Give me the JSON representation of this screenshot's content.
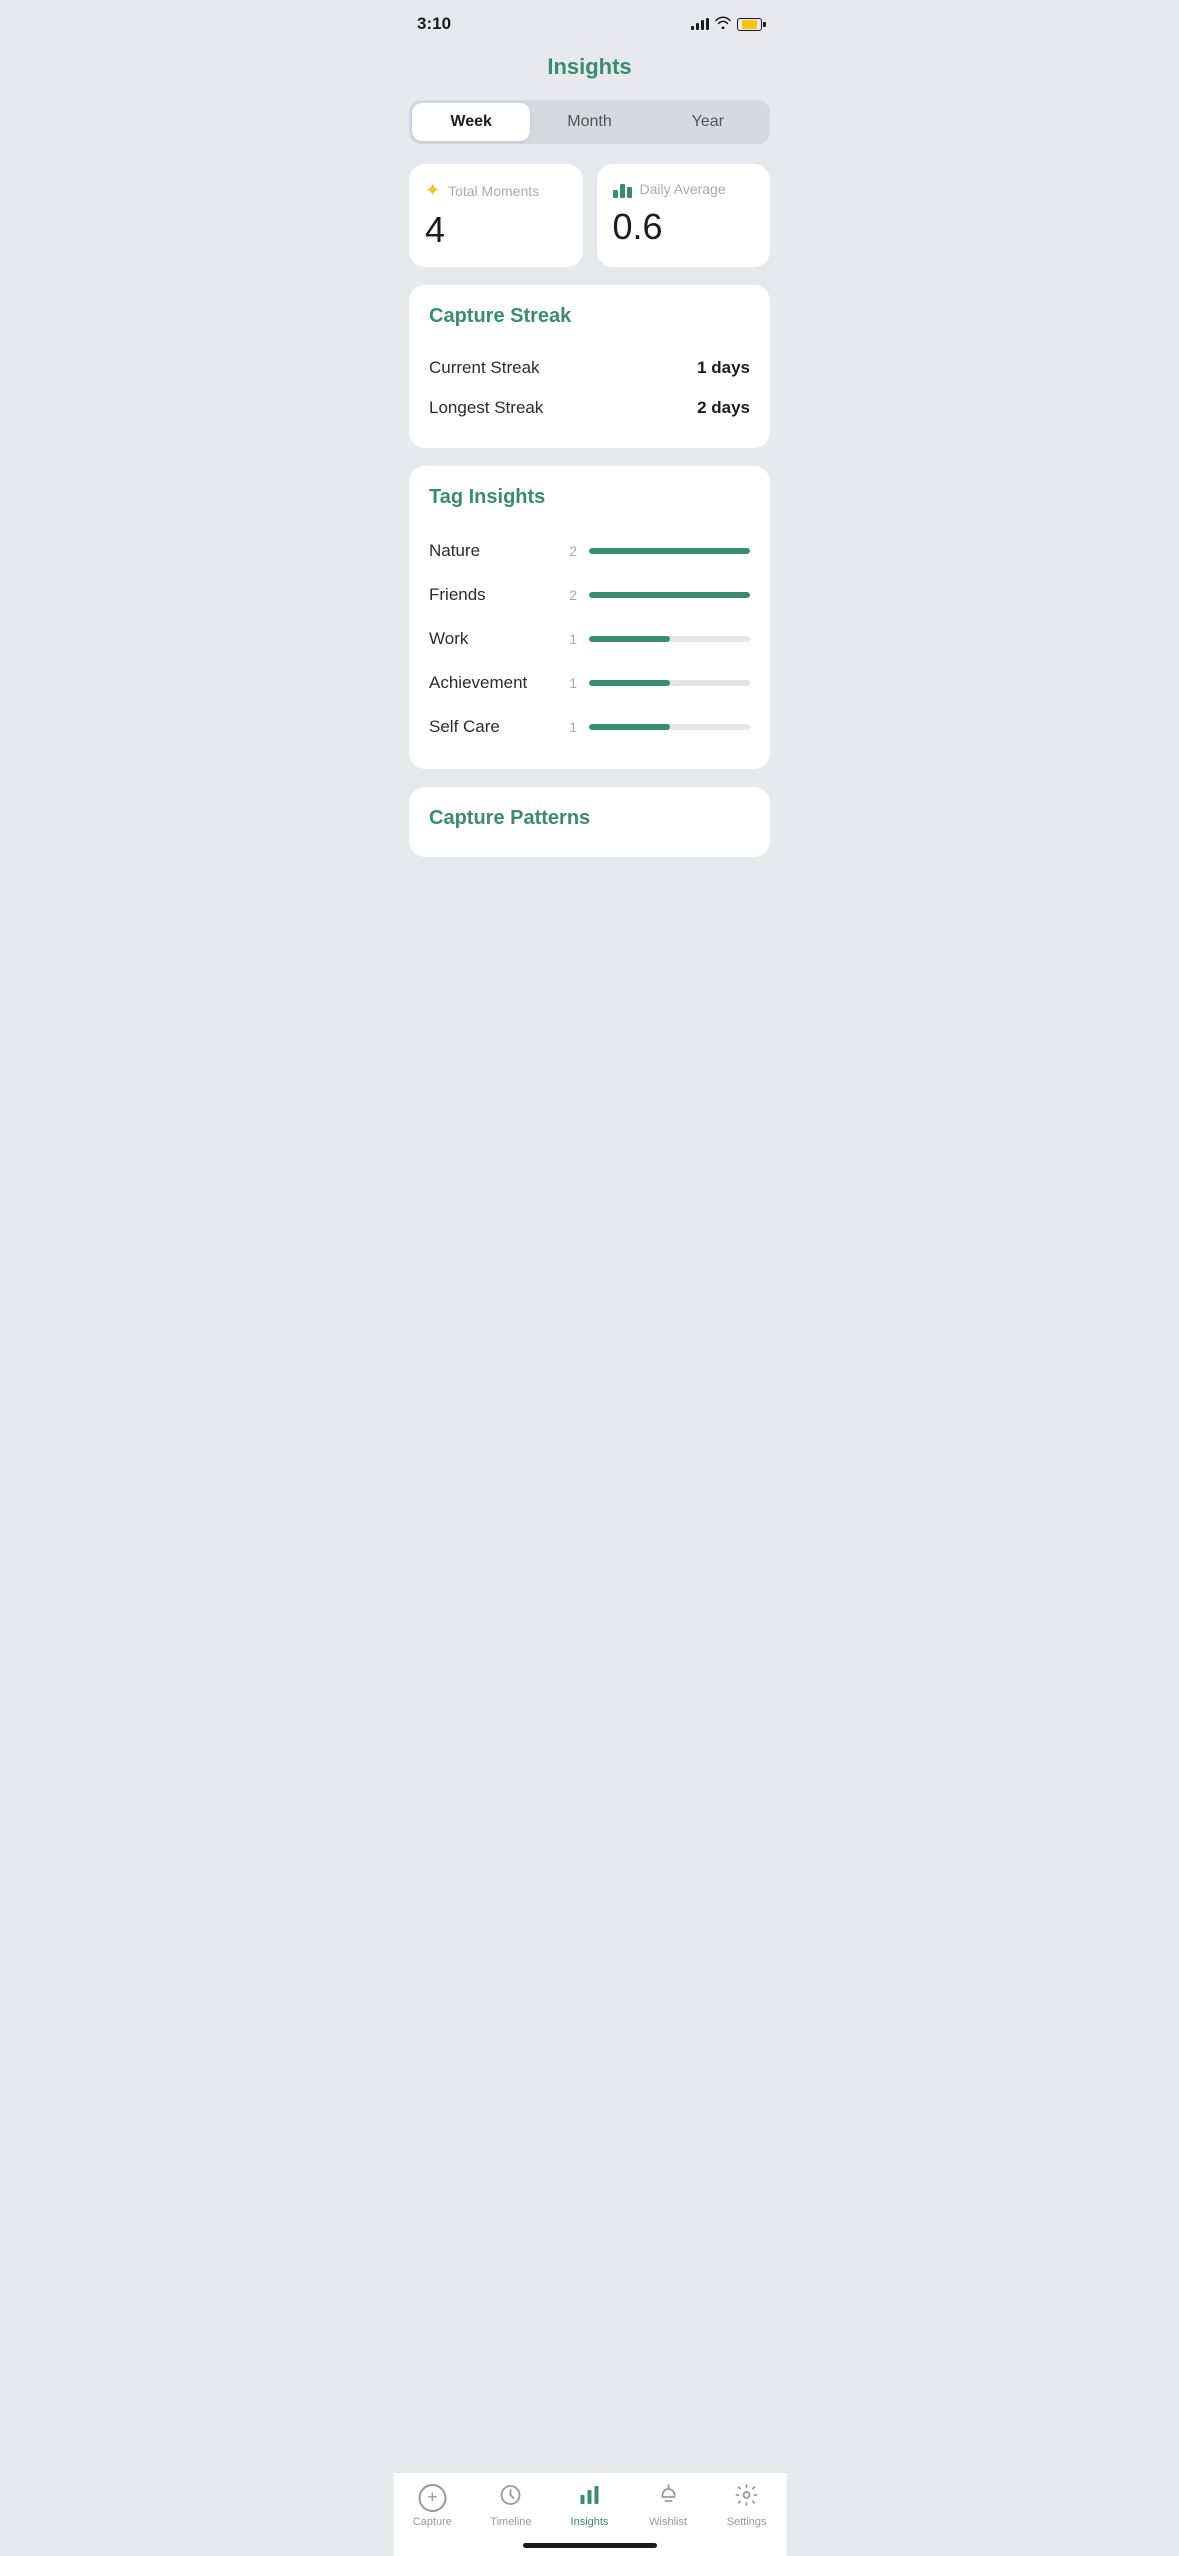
{
  "statusBar": {
    "time": "3:10"
  },
  "header": {
    "title": "Insights"
  },
  "tabs": {
    "items": [
      "Week",
      "Month",
      "Year"
    ],
    "activeIndex": 0
  },
  "statsCards": {
    "totalMoments": {
      "label": "Total Moments",
      "value": "4"
    },
    "dailyAverage": {
      "label": "Daily Average",
      "value": "0.6"
    }
  },
  "captureStreak": {
    "title": "Capture Streak",
    "currentLabel": "Current Streak",
    "currentValue": "1 days",
    "longestLabel": "Longest Streak",
    "longestValue": "2 days"
  },
  "tagInsights": {
    "title": "Tag Insights",
    "tags": [
      {
        "name": "Nature",
        "count": 2,
        "maxCount": 2
      },
      {
        "name": "Friends",
        "count": 2,
        "maxCount": 2
      },
      {
        "name": "Work",
        "count": 1,
        "maxCount": 2
      },
      {
        "name": "Achievement",
        "count": 1,
        "maxCount": 2
      },
      {
        "name": "Self Care",
        "count": 1,
        "maxCount": 2
      }
    ]
  },
  "capturePatterns": {
    "title": "Capture Patterns"
  },
  "tabBar": {
    "items": [
      {
        "id": "capture",
        "label": "Capture",
        "icon": "+"
      },
      {
        "id": "timeline",
        "label": "Timeline"
      },
      {
        "id": "insights",
        "label": "Insights"
      },
      {
        "id": "wishlist",
        "label": "Wishlist"
      },
      {
        "id": "settings",
        "label": "Settings"
      }
    ]
  }
}
